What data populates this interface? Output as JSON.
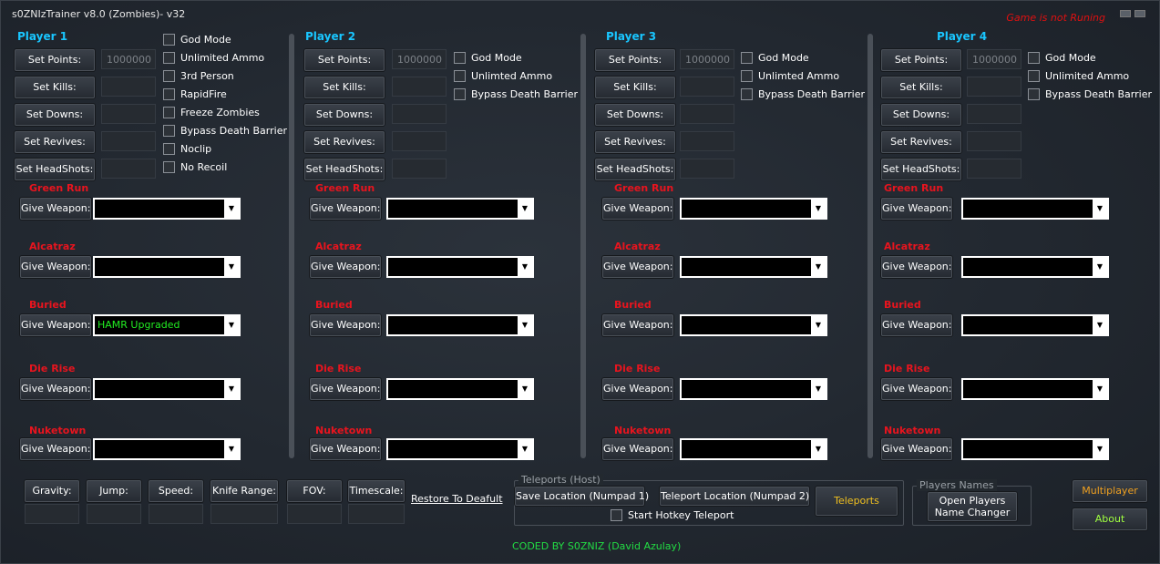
{
  "app": {
    "title": "s0ZNIzTrainer v8.0  (Zombies)- v32",
    "status": "Game is not Runing"
  },
  "labels": {
    "set_points": "Set Points:",
    "set_kills": "Set Kills:",
    "set_downs": "Set Downs:",
    "set_revives": "Set Revives:",
    "set_headshots": "Set HeadShots:",
    "give_weapon": "Give Weapon:"
  },
  "maps": [
    "Green Run",
    "Alcatraz",
    "Buried",
    "Die Rise",
    "Nuketown"
  ],
  "players": [
    {
      "title": "Player 1",
      "points_value": "1000000",
      "options": [
        "God Mode",
        "Unlimited Ammo",
        "3rd Person",
        "RapidFire",
        "Freeze Zombies",
        "Bypass Death Barrier",
        "Noclip",
        "No Recoil"
      ],
      "weapons": [
        "",
        "",
        "HAMR Upgraded",
        "",
        ""
      ]
    },
    {
      "title": "Player 2",
      "points_value": "1000000",
      "options": [
        "God Mode",
        "Unlimted Ammo",
        "Bypass Death Barrier"
      ],
      "weapons": [
        "",
        "",
        "",
        "",
        ""
      ]
    },
    {
      "title": "Player 3",
      "points_value": "1000000",
      "options": [
        "God Mode",
        "Unlimted Ammo",
        "Bypass Death Barrier"
      ],
      "weapons": [
        "",
        "",
        "",
        "",
        ""
      ]
    },
    {
      "title": "Player 4",
      "points_value": "1000000",
      "options": [
        "God Mode",
        "Unlimited Ammo",
        "Bypass Death Barrier"
      ],
      "weapons": [
        "",
        "",
        "",
        "",
        ""
      ]
    }
  ],
  "bottom": {
    "gravity": "Gravity:",
    "jump": "Jump:",
    "speed": "Speed:",
    "knife_range": "Knife Range:",
    "fov": "FOV:",
    "timescale": "Timescale:",
    "restore": "Restore To Deafult",
    "teleports_group": "Teleports (Host)",
    "save_location": "Save Location (Numpad 1)",
    "teleport_location": "Teleport Location (Numpad 2)",
    "teleports": "Teleports",
    "start_hotkey": "Start Hotkey Teleport",
    "players_names_group": "Players Names",
    "open_players_1": "Open Players",
    "open_players_2": "Name Changer",
    "multiplayer": "Multiplayer",
    "about": "About",
    "credit": "CODED BY S0ZNIZ (David Azulay)"
  },
  "colors": {
    "accent_cyan": "#19c6ff",
    "map_red": "#e8141e",
    "status_red": "#e01010",
    "weapon_green": "#22ee22",
    "multiplayer_orange": "#f0a020",
    "about_green": "#a0ff40"
  }
}
